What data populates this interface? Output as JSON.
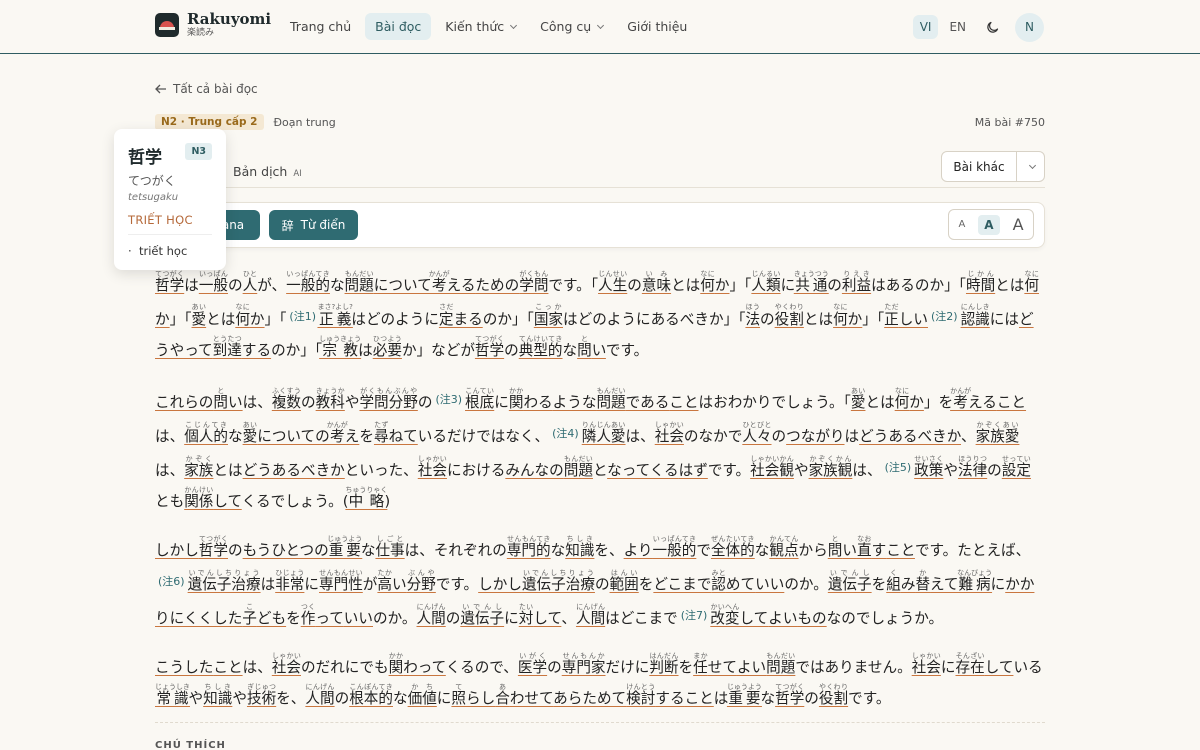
{
  "app": {
    "title": "Rakuyomi",
    "subtitle": "楽読み"
  },
  "nav": [
    {
      "label": "Trang chủ",
      "active": false,
      "dropdown": false
    },
    {
      "label": "Bài đọc",
      "active": true,
      "dropdown": false
    },
    {
      "label": "Kiến thức",
      "active": false,
      "dropdown": true
    },
    {
      "label": "Công cụ",
      "active": false,
      "dropdown": true
    },
    {
      "label": "Giới thiệu",
      "active": false,
      "dropdown": false
    }
  ],
  "header_right": {
    "lang_vi": "VI",
    "lang_en": "EN",
    "avatar": "N",
    "theme_icon": "moon-icon"
  },
  "back_link": "Tất cả bài đọc",
  "meta": {
    "level": "N2 · Trung cấp 2",
    "type": "Đoạn trung",
    "lesson_no": "Mã bài #750"
  },
  "tabs": {
    "translation": "Bản dịch",
    "ai_badge": "AI"
  },
  "other_button": "Bài khác",
  "toolbar": {
    "kana_label": "ana",
    "dict_label": "Từ điển",
    "dict_icon": "辞",
    "size_small": "A",
    "size_medium": "A",
    "size_large": "A"
  },
  "popup": {
    "word": "哲学",
    "badge": "N3",
    "kana": "てつがく",
    "romaji": "tetsugaku",
    "meaning": "TRIẾT HỌC",
    "definition": "triết học"
  },
  "notes_title": "CHÚ THÍCH",
  "colors": {
    "accent": "#2f6b72",
    "underline": "#c9763f",
    "background": "#faf8f3"
  }
}
